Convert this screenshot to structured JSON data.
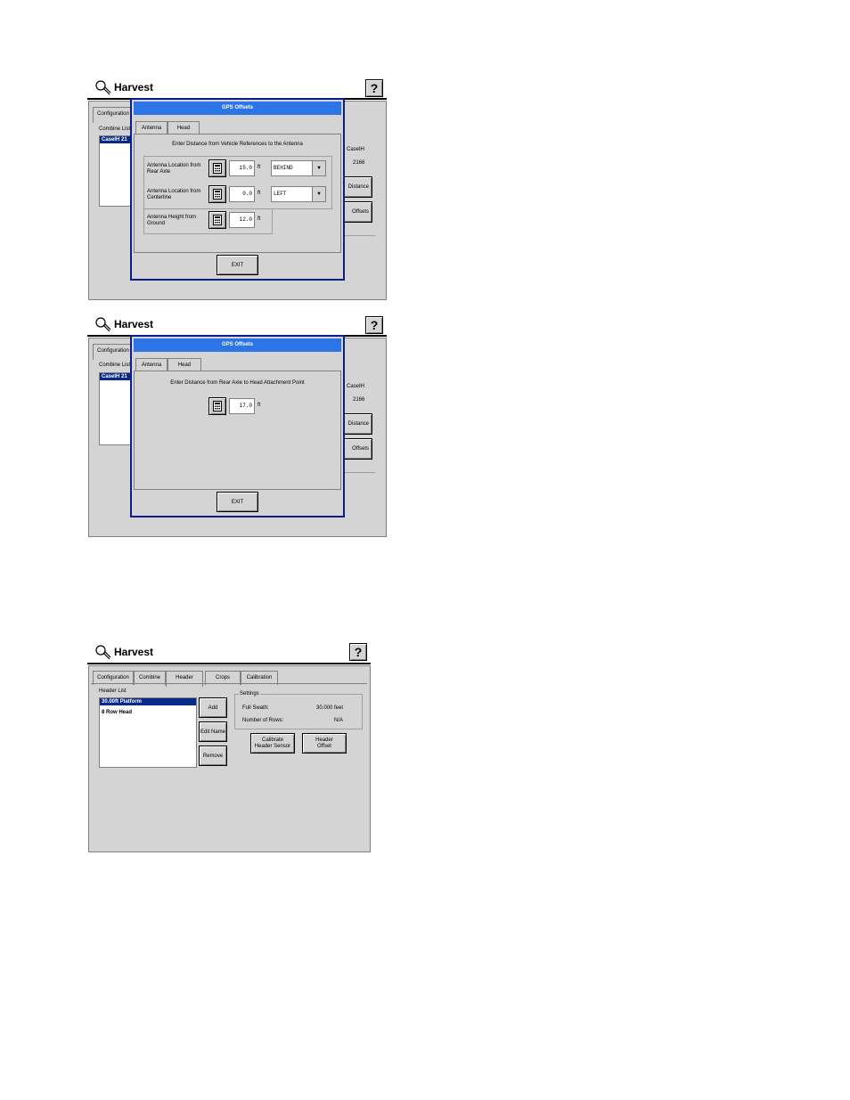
{
  "app": {
    "title": "Harvest",
    "help_label": "?"
  },
  "screen1": {
    "bg_tab": "Configuration",
    "bg_list_label": "Combine List",
    "bg_list_item": "CaseIH 21",
    "bg_right_label_1": "CaseIH",
    "bg_right_label_2": "2166",
    "bg_btn_1": "Distance",
    "bg_btn_2": "Offsets",
    "dialog": {
      "title": "GPS Offsets",
      "tabs": [
        "Antenna",
        "Head"
      ],
      "instruction": "Enter Distance from Vehicle References to the Antenna",
      "rows": [
        {
          "label": "Antenna Location from Rear Axle",
          "value": "15.0",
          "unit": "ft",
          "select": "BEHIND"
        },
        {
          "label": "Antenna Location from Centerline",
          "value": "0.0",
          "unit": "ft",
          "select": "LEFT"
        },
        {
          "label": "Antenna Height from Ground",
          "value": "12.0",
          "unit": "ft"
        }
      ],
      "exit_label": "EXIT"
    }
  },
  "screen2": {
    "bg_tab": "Configuration",
    "bg_list_label": "Combine List",
    "bg_list_item": "CaseIH 21",
    "bg_right_label_1": "CaseIH",
    "bg_right_label_2": "2166",
    "bg_btn_1": "Distance",
    "bg_btn_2": "Offsets",
    "dialog": {
      "title": "GPS Offsets",
      "tabs": [
        "Antenna",
        "Head"
      ],
      "instruction": "Enter Distance from Rear Axle to Head Attachment Point",
      "value": "17.0",
      "unit": "ft",
      "exit_label": "EXIT"
    }
  },
  "screen3": {
    "tabs": [
      "Configuration",
      "Combine",
      "Header",
      "Crops",
      "Calibration"
    ],
    "list_label": "Header List",
    "list_items": [
      "30.00ft Platform",
      "8 Row Head"
    ],
    "buttons": {
      "add": "Add",
      "edit_name": "Edit Name",
      "remove": "Remove"
    },
    "settings": {
      "title": "Settings",
      "full_swath_label": "Full Swath:",
      "full_swath_value": "30.000 feet",
      "rows_label": "Number of Rows:",
      "rows_value": "N/A"
    },
    "calibrate_label_1": "Calibrate",
    "calibrate_label_2": "Header Sensor",
    "offset_label_1": "Header",
    "offset_label_2": "Offset"
  }
}
